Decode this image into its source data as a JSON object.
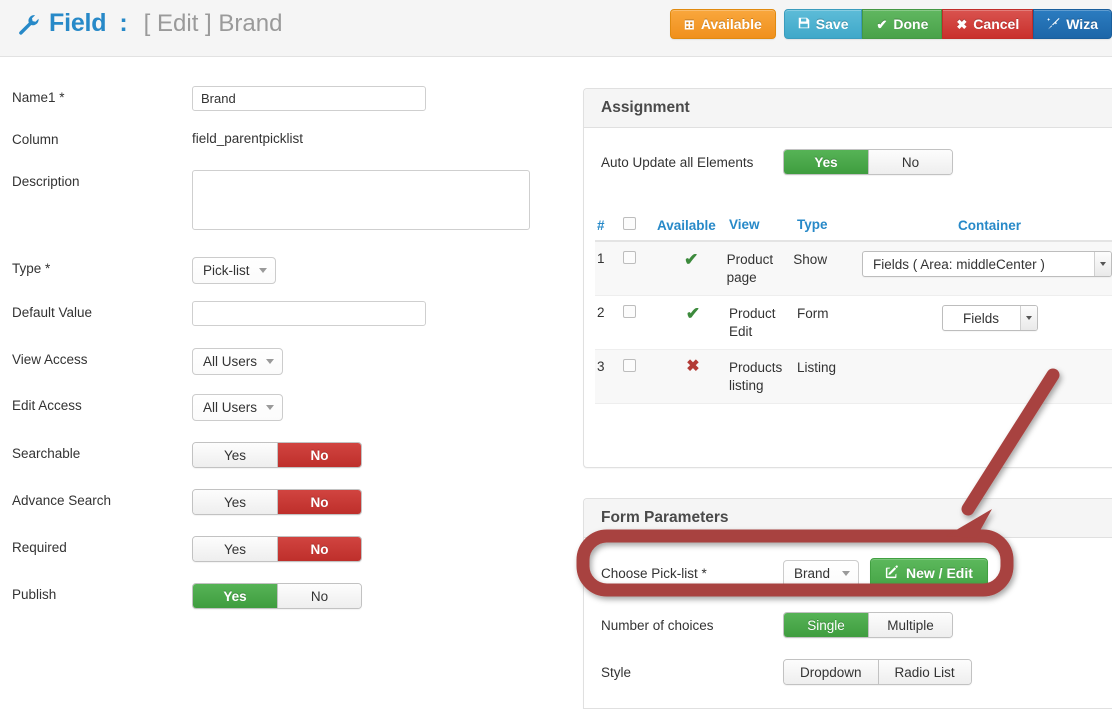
{
  "header": {
    "icon": "wrench-icon",
    "title": "Field",
    "separator": ":",
    "subtitle": "[ Edit ] Brand",
    "buttons": [
      {
        "id": "available",
        "label": "Available",
        "icon": "plus-square-icon",
        "color": "#f0901c"
      },
      {
        "id": "save",
        "label": "Save",
        "icon": "floppy-disk-icon",
        "color": "#3fa8c9"
      },
      {
        "id": "done",
        "label": "Done",
        "icon": "check-icon",
        "color": "#4aa24a"
      },
      {
        "id": "cancel",
        "label": "Cancel",
        "icon": "x-icon",
        "color": "#c9302c"
      },
      {
        "id": "wizard",
        "label": "Wiza",
        "icon": "magic-wand-icon",
        "color": "#1d66a8"
      }
    ]
  },
  "form": {
    "name1": {
      "label": "Name1 *",
      "value": "Brand",
      "placeholder": ""
    },
    "column": {
      "label": "Column",
      "value": "field_parentpicklist"
    },
    "description": {
      "label": "Description",
      "value": "",
      "placeholder": ""
    },
    "type": {
      "label": "Type *",
      "value": "Pick-list"
    },
    "default_value": {
      "label": "Default Value",
      "value": "",
      "placeholder": ""
    },
    "view_access": {
      "label": "View Access",
      "value": "All Users"
    },
    "edit_access": {
      "label": "Edit Access",
      "value": "All Users"
    },
    "searchable": {
      "label": "Searchable",
      "yes": "Yes",
      "no": "No",
      "selected": "No"
    },
    "advance_search": {
      "label": "Advance Search",
      "yes": "Yes",
      "no": "No",
      "selected": "No"
    },
    "required": {
      "label": "Required",
      "yes": "Yes",
      "no": "No",
      "selected": "No"
    },
    "publish": {
      "label": "Publish",
      "yes": "Yes",
      "no": "No",
      "selected": "Yes"
    }
  },
  "assignment": {
    "panel_title": "Assignment",
    "auto_update": {
      "label": "Auto Update all Elements",
      "yes": "Yes",
      "no": "No",
      "selected": "Yes"
    },
    "columns": [
      "#",
      "",
      "Available",
      "View",
      "Type",
      "Container"
    ],
    "rows": [
      {
        "num": "1",
        "checked": false,
        "available": "check",
        "view": "Product page",
        "type": "Show",
        "container": "Fields ( Area: middleCenter )",
        "container_width": "wide"
      },
      {
        "num": "2",
        "checked": false,
        "available": "check",
        "view": "Product Edit",
        "type": "Form",
        "container": "Fields",
        "container_width": "narrow"
      },
      {
        "num": "3",
        "checked": false,
        "available": "cross",
        "view": "Products listing",
        "type": "Listing",
        "container": "",
        "container_width": "none"
      }
    ]
  },
  "form_parameters": {
    "panel_title": "Form Parameters",
    "choose_picklist": {
      "label": "Choose Pick-list *",
      "value": "Brand",
      "button_label": "New / Edit",
      "button_icon": "pencil-square-icon"
    },
    "number_of_choices": {
      "label": "Number of choices",
      "options": [
        "Single",
        "Multiple"
      ],
      "selected": "Single"
    },
    "style": {
      "label": "Style",
      "options": [
        "Dropdown",
        "Radio List"
      ],
      "selected": ""
    }
  },
  "annotation": {
    "highlight_color": "#a8433f",
    "shape": "rounded-rectangle-highlight",
    "arrow": "arrow-pointing-to-new-edit-row"
  },
  "colors": {
    "brand_blue": "#2789c8",
    "green": "#4aa24a",
    "red": "#c9302c",
    "orange": "#f0901c",
    "panel_header_bg": "#f5f5f5"
  }
}
